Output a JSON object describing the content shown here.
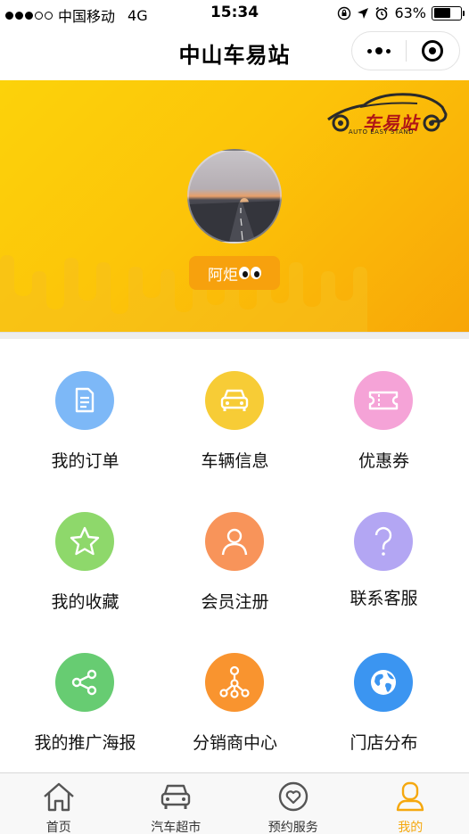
{
  "status_bar": {
    "carrier": "中国移动",
    "network": "4G",
    "time": "15:34",
    "battery_percent": "63%",
    "battery_level": 0.63
  },
  "nav": {
    "title": "中山车易站"
  },
  "banner": {
    "logo_text": "车易站",
    "logo_sub": "AUTO EASY STAND",
    "user_name": "阿炬",
    "colors": {
      "banner_start": "#fcd20a",
      "banner_end": "#f8a607",
      "badge": "#f7a10d"
    }
  },
  "menu": {
    "items": [
      {
        "label": "我的订单",
        "icon": "document-icon",
        "color": "#7db8f7"
      },
      {
        "label": "车辆信息",
        "icon": "car-icon",
        "color": "#f7cc36"
      },
      {
        "label": "优惠券",
        "icon": "ticket-icon",
        "color": "#f5a3d7"
      },
      {
        "label": "我的收藏",
        "icon": "star-icon",
        "color": "#8ed86b"
      },
      {
        "label": "会员注册",
        "icon": "user-icon",
        "color": "#f8945a"
      },
      {
        "label": "联系客服",
        "icon": "question-icon",
        "color": "#b3a6f3"
      },
      {
        "label": "我的推广海报",
        "icon": "share-icon",
        "color": "#67cc72"
      },
      {
        "label": "分销商中心",
        "icon": "network-icon",
        "color": "#f9942f"
      },
      {
        "label": "门店分布",
        "icon": "globe-icon",
        "color": "#3b95f1"
      }
    ]
  },
  "tab_bar": {
    "items": [
      {
        "label": "首页",
        "icon": "home-icon"
      },
      {
        "label": "汽车超市",
        "icon": "car-icon"
      },
      {
        "label": "预约服务",
        "icon": "heart-icon"
      },
      {
        "label": "我的",
        "icon": "person-icon"
      }
    ],
    "active_color": "#f5a80f"
  }
}
